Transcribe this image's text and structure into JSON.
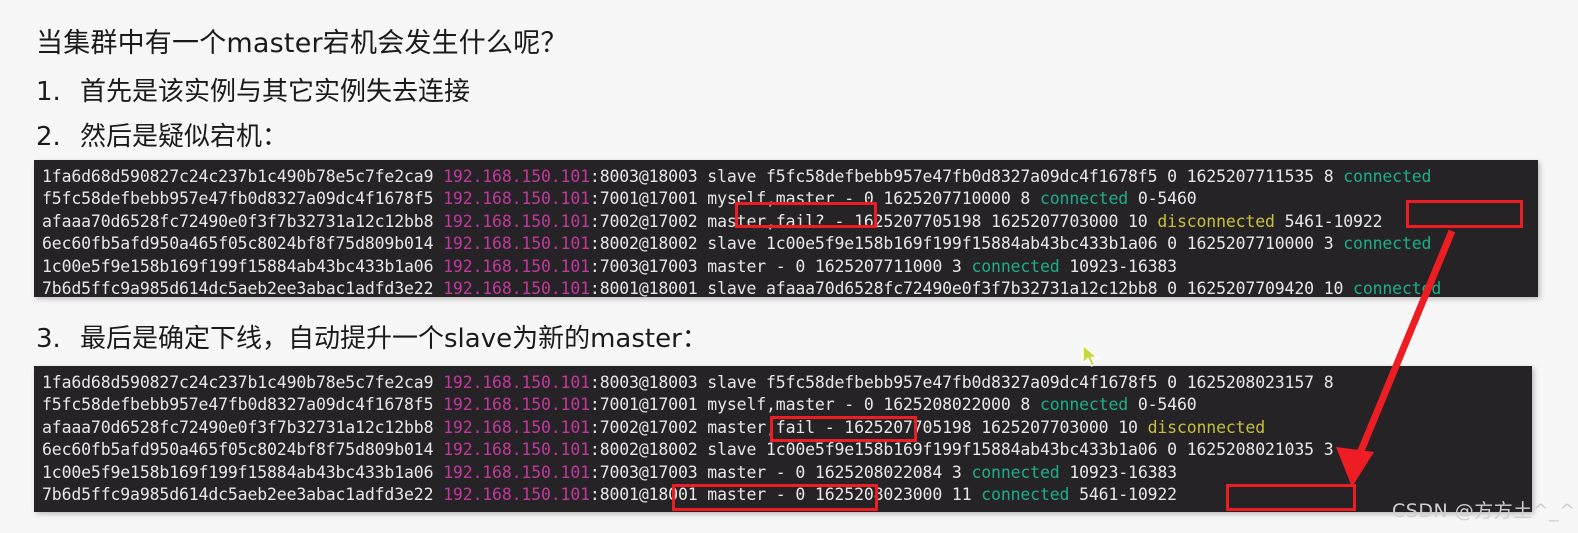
{
  "prose": {
    "question": "当集群中有一个master宕机会发生什么呢？",
    "items": [
      {
        "num": "1.",
        "text": "首先是该实例与其它实例失去连接"
      },
      {
        "num": "2.",
        "text": "然后是疑似宕机："
      },
      {
        "num": "3.",
        "text": "最后是确定下线，自动提升一个slave为新的master："
      }
    ]
  },
  "colors": {
    "terminal_bg": "#262326",
    "terminal_fg": "#e8e8e8",
    "ip_magenta": "#c0399b",
    "connected_green": "#1aaf8a",
    "disconnected_yellow": "#c6c13c",
    "annotation_red": "#ee1d24",
    "page_bg": "#f7f7f7"
  },
  "terminal1": {
    "name": "cluster-nodes-output-suspected-failure",
    "lines": [
      [
        {
          "t": "1fa6d68d590827c24c237b1c490b78e5c7fe2ca9 ",
          "c": "def"
        },
        {
          "t": "192.168.150.101",
          "c": "ip"
        },
        {
          "t": ":8003@18003 slave f5fc58defbebb957e47fb0d8327a09dc4f1678f5 0 1625207711535 8 ",
          "c": "def"
        },
        {
          "t": "connected",
          "c": "ok"
        }
      ],
      [
        {
          "t": "f5fc58defbebb957e47fb0d8327a09dc4f1678f5 ",
          "c": "def"
        },
        {
          "t": "192.168.150.101",
          "c": "ip"
        },
        {
          "t": ":7001@17001 myself,master - 0 1625207710000 8 ",
          "c": "def"
        },
        {
          "t": "connected",
          "c": "ok"
        },
        {
          "t": " 0-5460",
          "c": "def"
        }
      ],
      [
        {
          "t": "afaaa70d6528fc72490e0f3f7b32731a12c12bb8 ",
          "c": "def"
        },
        {
          "t": "192.168.150.101",
          "c": "ip"
        },
        {
          "t": ":7002@17002 master,fail? - 1625207705198 1625207703000 10 ",
          "c": "def"
        },
        {
          "t": "disconnected",
          "c": "bad"
        },
        {
          "t": " 5461-10922",
          "c": "def"
        }
      ],
      [
        {
          "t": "6ec60fb5afd950a465f05c8024bf8f75d809b014 ",
          "c": "def"
        },
        {
          "t": "192.168.150.101",
          "c": "ip"
        },
        {
          "t": ":8002@18002 slave 1c00e5f9e158b169f199f15884ab43bc433b1a06 0 1625207710000 3 ",
          "c": "def"
        },
        {
          "t": "connected",
          "c": "ok"
        }
      ],
      [
        {
          "t": "1c00e5f9e158b169f199f15884ab43bc433b1a06 ",
          "c": "def"
        },
        {
          "t": "192.168.150.101",
          "c": "ip"
        },
        {
          "t": ":7003@17003 master - 0 1625207711000 3 ",
          "c": "def"
        },
        {
          "t": "connected",
          "c": "ok"
        },
        {
          "t": " 10923-16383",
          "c": "def"
        }
      ],
      [
        {
          "t": "7b6d5ffc9a985d614dc5aeb2ee3abac1adfd3e22 ",
          "c": "def"
        },
        {
          "t": "192.168.150.101",
          "c": "ip"
        },
        {
          "t": ":8001@18001 slave afaaa70d6528fc72490e0f3f7b32731a12c12bb8 0 1625207709420 10 ",
          "c": "def"
        },
        {
          "t": "connected",
          "c": "ok"
        }
      ]
    ]
  },
  "terminal2": {
    "name": "cluster-nodes-output-failover-complete",
    "lines": [
      [
        {
          "t": "1fa6d68d590827c24c237b1c490b78e5c7fe2ca9 ",
          "c": "def"
        },
        {
          "t": "192.168.150.101",
          "c": "ip"
        },
        {
          "t": ":8003@18003 slave f5fc58defbebb957e47fb0d8327a09dc4f1678f5 0 1625208023157 8 ",
          "c": "def"
        }
      ],
      [
        {
          "t": "f5fc58defbebb957e47fb0d8327a09dc4f1678f5 ",
          "c": "def"
        },
        {
          "t": "192.168.150.101",
          "c": "ip"
        },
        {
          "t": ":7001@17001 myself,master - 0 1625208022000 8 ",
          "c": "def"
        },
        {
          "t": "connected",
          "c": "ok"
        },
        {
          "t": " 0-5460",
          "c": "def"
        }
      ],
      [
        {
          "t": "afaaa70d6528fc72490e0f3f7b32731a12c12bb8 ",
          "c": "def"
        },
        {
          "t": "192.168.150.101",
          "c": "ip"
        },
        {
          "t": ":7002@17002 master,fail - 1625207705198 1625207703000 10 ",
          "c": "def"
        },
        {
          "t": "disconnected",
          "c": "bad"
        }
      ],
      [
        {
          "t": "6ec60fb5afd950a465f05c8024bf8f75d809b014 ",
          "c": "def"
        },
        {
          "t": "192.168.150.101",
          "c": "ip"
        },
        {
          "t": ":8002@18002 slave 1c00e5f9e158b169f199f15884ab43bc433b1a06 0 1625208021035 3 ",
          "c": "def"
        }
      ],
      [
        {
          "t": "1c00e5f9e158b169f199f15884ab43bc433b1a06 ",
          "c": "def"
        },
        {
          "t": "192.168.150.101",
          "c": "ip"
        },
        {
          "t": ":7003@17003 master - 0 1625208022084 3 ",
          "c": "def"
        },
        {
          "t": "connected",
          "c": "ok"
        },
        {
          "t": " 10923-16383",
          "c": "def"
        }
      ],
      [
        {
          "t": "7b6d5ffc9a985d614dc5aeb2ee3abac1adfd3e22 ",
          "c": "def"
        },
        {
          "t": "192.168.150.101",
          "c": "ip"
        },
        {
          "t": ":8001@18001 master - 0 1625208023000 11 ",
          "c": "def"
        },
        {
          "t": "connected",
          "c": "ok"
        },
        {
          "t": " 5461-10922",
          "c": "def"
        }
      ]
    ]
  },
  "annotations": {
    "box_fail_suspected": "master,fail?",
    "box_slots_orphaned": "5461-10922",
    "box_fail_confirmed": "master,fail",
    "box_new_master": "8001@18001 master",
    "box_slots_migrated": "5461-10922",
    "arrow": "red-arrow-slots-migration"
  },
  "watermark": "CSDN @方方土^_^"
}
